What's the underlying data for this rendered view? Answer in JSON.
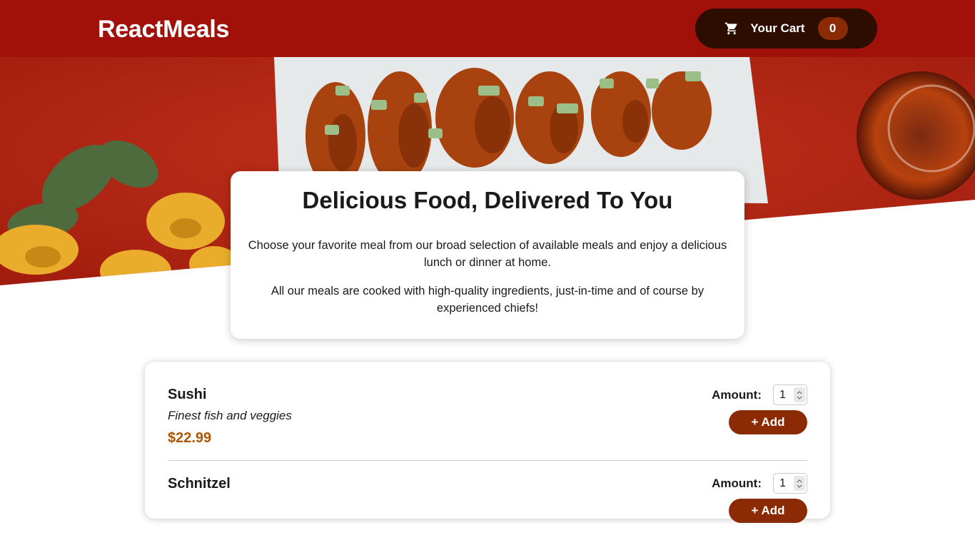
{
  "header": {
    "logo": "ReactMeals",
    "cart": {
      "icon": "shopping-cart-icon",
      "label": "Your Cart",
      "count": "0"
    }
  },
  "hero": {
    "image": "table-of-food-photo"
  },
  "summary": {
    "title": "Delicious Food, Delivered To You",
    "paragraph1": "Choose your favorite meal from our broad selection of available meals and enjoy a delicious lunch or dinner at home.",
    "paragraph2": "All our meals are cooked with high-quality ingredients, just-in-time and of course by experienced chiefs!"
  },
  "meals": [
    {
      "name": "Sushi",
      "description": "Finest fish and veggies",
      "price": "$22.99",
      "amount_label": "Amount:",
      "amount_value": "1",
      "add_label": "+ Add"
    },
    {
      "name": "Schnitzel",
      "description": "",
      "price": "",
      "amount_label": "Amount:",
      "amount_value": "1",
      "add_label": "+ Add"
    }
  ],
  "colors": {
    "header": "#a1110a",
    "cart_button": "#2c0d00",
    "badge": "#8a2b06",
    "add_button": "#8a2b06",
    "price": "#ad5502"
  }
}
